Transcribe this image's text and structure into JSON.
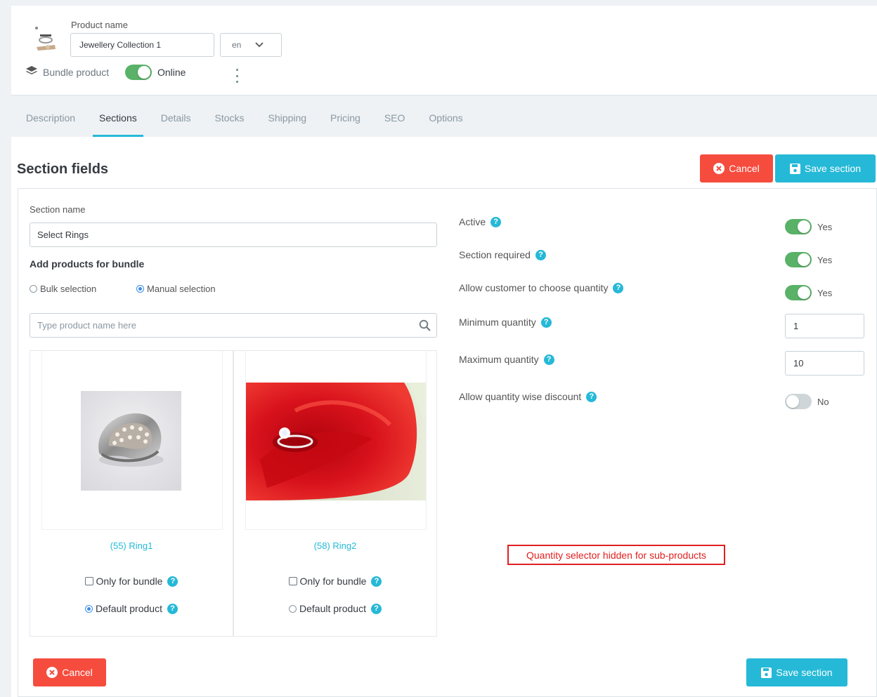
{
  "header": {
    "product_name_label": "Product name",
    "product_name_value": "Jewellery Collection 1",
    "language": "en",
    "product_type": "Bundle product",
    "status_label": "Online"
  },
  "tabs": [
    {
      "label": "Description"
    },
    {
      "label": "Sections"
    },
    {
      "label": "Details"
    },
    {
      "label": "Stocks"
    },
    {
      "label": "Shipping"
    },
    {
      "label": "Pricing"
    },
    {
      "label": "SEO"
    },
    {
      "label": "Options"
    }
  ],
  "active_tab": "Sections",
  "panel": {
    "title": "Section fields",
    "cancel_label": "Cancel",
    "save_label": "Save section"
  },
  "section": {
    "name_label": "Section name",
    "name_value": "Select Rings",
    "add_products_label": "Add products for bundle",
    "bulk_label": "Bulk selection",
    "manual_label": "Manual selection",
    "selected_mode": "Manual selection",
    "search_placeholder": "Type product name here"
  },
  "products": [
    {
      "link": "(55) Ring1",
      "only_bundle_label": "Only for bundle",
      "only_bundle_checked": false,
      "default_label": "Default product",
      "default_checked": true
    },
    {
      "link": "(58) Ring2",
      "only_bundle_label": "Only for bundle",
      "only_bundle_checked": false,
      "default_label": "Default product",
      "default_checked": false
    }
  ],
  "settings": {
    "active": {
      "label": "Active",
      "value": "Yes",
      "on": true
    },
    "required": {
      "label": "Section required",
      "value": "Yes",
      "on": true
    },
    "choose_qty": {
      "label": "Allow customer to choose quantity",
      "value": "Yes",
      "on": true
    },
    "min_qty": {
      "label": "Minimum quantity",
      "value": "1"
    },
    "max_qty": {
      "label": "Maximum quantity",
      "value": "10"
    },
    "qty_discount": {
      "label": "Allow quantity wise discount",
      "value": "No",
      "on": false
    }
  },
  "note": "Quantity selector hidden for sub-products",
  "colors": {
    "accent": "#25b9d7",
    "cancel": "#f54c3e",
    "toggle_on": "#59b267",
    "note_red": "#e02020"
  },
  "icons": {
    "product_thumb": "jewellery-thumbnail-icon",
    "product_type": "layers-icon",
    "more": "kebab-menu-icon",
    "cancel": "close-circle-icon",
    "save": "floppy-disk-icon",
    "search": "search-icon",
    "help": "help-icon"
  }
}
